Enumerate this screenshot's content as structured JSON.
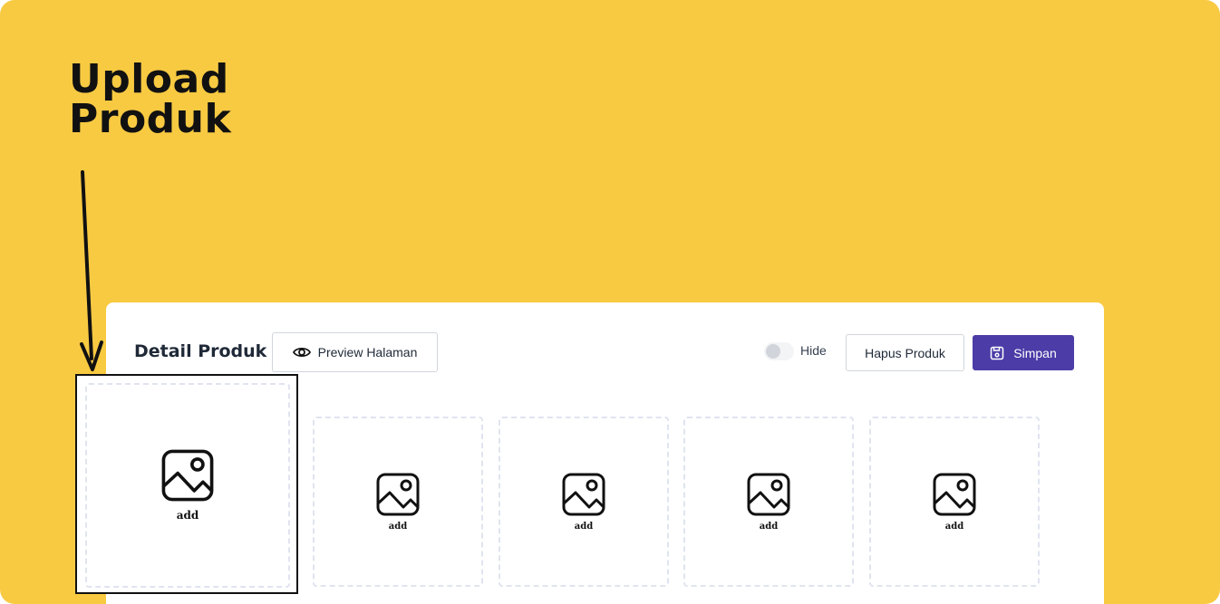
{
  "headline": {
    "line1": "Upload",
    "line2": "Produk"
  },
  "panel": {
    "title": "Detail Produk",
    "preview_label": "Preview Halaman",
    "hide_label": "Hide",
    "delete_label": "Hapus Produk",
    "save_label": "Simpan"
  },
  "image_slots": [
    {
      "label": "add",
      "icon": "image-icon"
    },
    {
      "label": "add",
      "icon": "image-icon"
    },
    {
      "label": "add",
      "icon": "image-icon"
    },
    {
      "label": "add",
      "icon": "image-icon"
    },
    {
      "label": "add",
      "icon": "image-icon"
    }
  ],
  "colors": {
    "background": "#F8CA42",
    "primary_button": "#4B3CA7",
    "panel": "#FFFFFF"
  }
}
